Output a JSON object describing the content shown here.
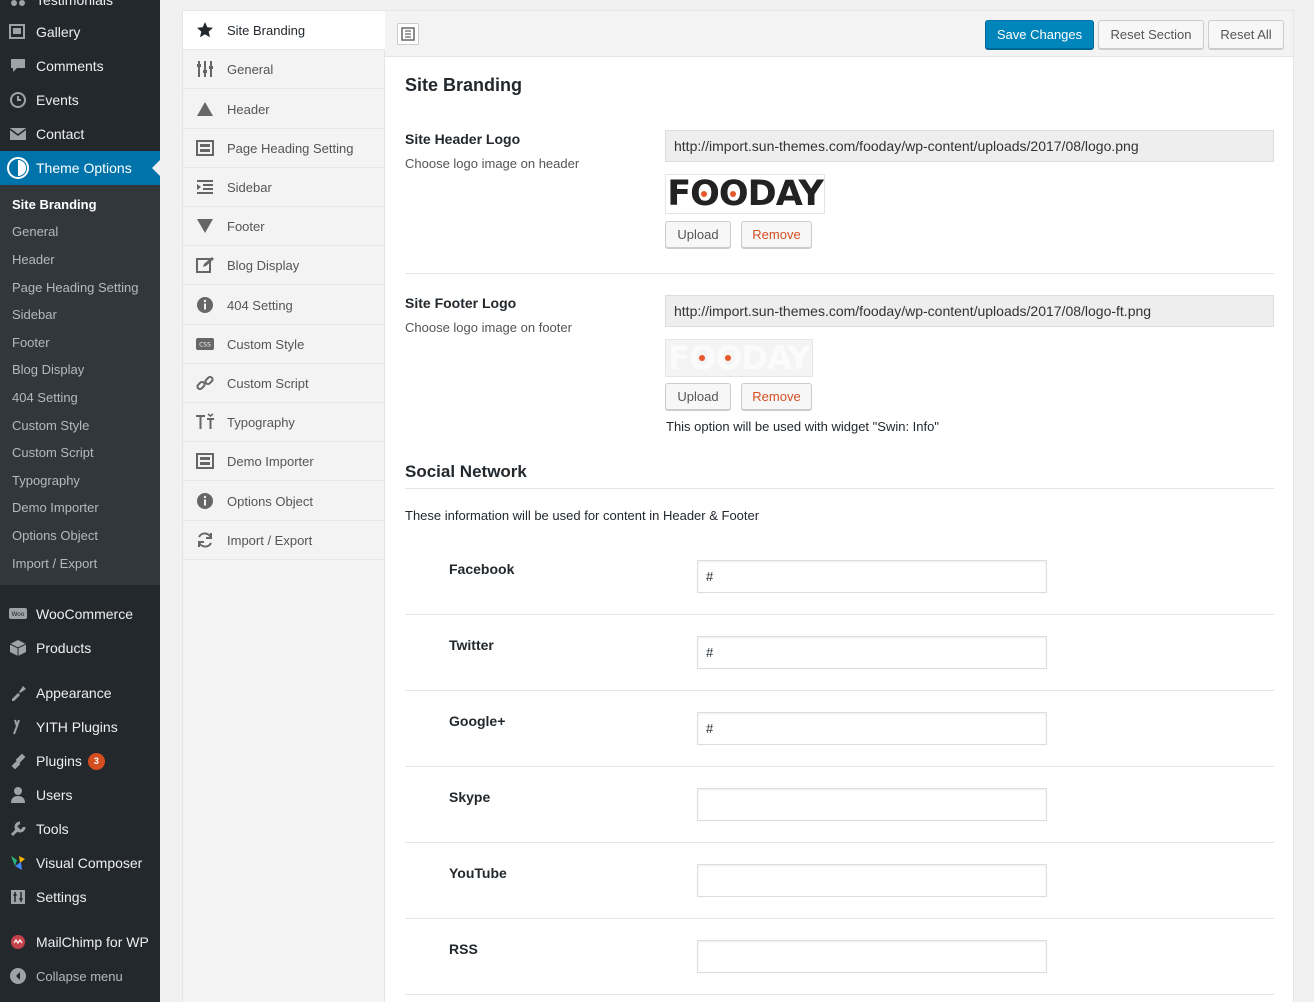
{
  "admin_menu": {
    "top_partial": "Testimonials",
    "items_before": [
      {
        "label": "Gallery",
        "icon": "gallery-icon"
      },
      {
        "label": "Comments",
        "icon": "comments-icon"
      },
      {
        "label": "Events",
        "icon": "clock-icon"
      },
      {
        "label": "Contact",
        "icon": "envelope-icon"
      }
    ],
    "current": {
      "label": "Theme Options",
      "icon": "theme-options-icon"
    },
    "submenu": [
      "Site Branding",
      "General",
      "Header",
      "Page Heading Setting",
      "Sidebar",
      "Footer",
      "Blog Display",
      "404 Setting",
      "Custom Style",
      "Custom Script",
      "Typography",
      "Demo Importer",
      "Options Object",
      "Import / Export"
    ],
    "items_after": [
      {
        "label": "WooCommerce",
        "icon": "woocommerce-icon"
      },
      {
        "label": "Products",
        "icon": "products-icon"
      },
      {
        "label": "Appearance",
        "icon": "appearance-icon"
      },
      {
        "label": "YITH Plugins",
        "icon": "yith-icon"
      },
      {
        "label": "Plugins",
        "icon": "plugins-icon",
        "badge": "3"
      },
      {
        "label": "Users",
        "icon": "users-icon"
      },
      {
        "label": "Tools",
        "icon": "tools-icon"
      },
      {
        "label": "Visual Composer",
        "icon": "visual-composer-icon"
      },
      {
        "label": "Settings",
        "icon": "settings-icon"
      },
      {
        "label": "MailChimp for WP",
        "icon": "mailchimp-icon"
      },
      {
        "label": "Collapse menu",
        "icon": "collapse-icon"
      }
    ]
  },
  "options_nav": [
    {
      "label": "Site Branding",
      "icon": "star-icon"
    },
    {
      "label": "General",
      "icon": "sliders-icon"
    },
    {
      "label": "Header",
      "icon": "triangle-up-icon"
    },
    {
      "label": "Page Heading Setting",
      "icon": "window-icon"
    },
    {
      "label": "Sidebar",
      "icon": "list-indent-icon"
    },
    {
      "label": "Footer",
      "icon": "triangle-down-icon"
    },
    {
      "label": "Blog Display",
      "icon": "edit-icon"
    },
    {
      "label": "404 Setting",
      "icon": "info-icon"
    },
    {
      "label": "Custom Style",
      "icon": "css-icon"
    },
    {
      "label": "Custom Script",
      "icon": "link-icon"
    },
    {
      "label": "Typography",
      "icon": "typography-icon"
    },
    {
      "label": "Demo Importer",
      "icon": "window-icon"
    },
    {
      "label": "Options Object",
      "icon": "info-icon"
    },
    {
      "label": "Import / Export",
      "icon": "refresh-icon"
    }
  ],
  "header": {
    "save": "Save Changes",
    "reset_section": "Reset Section",
    "reset_all": "Reset All"
  },
  "section": {
    "title": "Site Branding",
    "header_logo": {
      "title": "Site Header Logo",
      "desc": "Choose logo image on header",
      "url": "http://import.sun-themes.com/fooday/wp-content/uploads/2017/08/logo.png",
      "logo_text": "FOODAY",
      "upload": "Upload",
      "remove": "Remove"
    },
    "footer_logo": {
      "title": "Site Footer Logo",
      "desc": "Choose logo image on footer",
      "url": "http://import.sun-themes.com/fooday/wp-content/uploads/2017/08/logo-ft.png",
      "logo_text": "FOODAY",
      "upload": "Upload",
      "remove": "Remove",
      "note": "This option will be used with widget \"Swin: Info\""
    }
  },
  "social": {
    "title": "Social Network",
    "desc": "These information will be used for content in Header & Footer",
    "fields": [
      {
        "label": "Facebook",
        "value": "#"
      },
      {
        "label": "Twitter",
        "value": "#"
      },
      {
        "label": "Google+",
        "value": "#"
      },
      {
        "label": "Skype",
        "value": ""
      },
      {
        "label": "YouTube",
        "value": ""
      },
      {
        "label": "RSS",
        "value": ""
      }
    ]
  },
  "colors": {
    "wp_primary": "#0073aa",
    "button_primary": "#0085ba",
    "remove": "#d54e21",
    "logo_dot": "#e8582a"
  }
}
